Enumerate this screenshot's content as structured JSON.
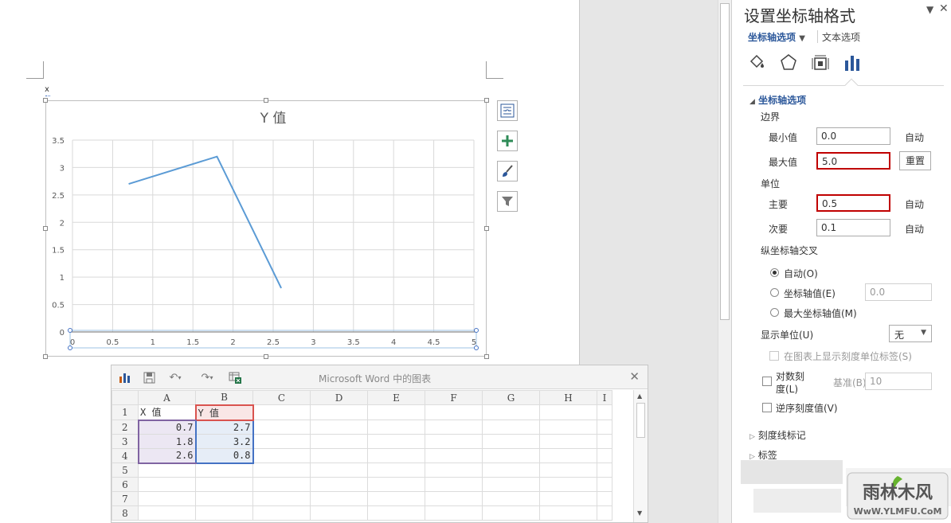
{
  "chart": {
    "title": "Y 值",
    "cursor_marker": "x"
  },
  "chart_data": {
    "type": "line",
    "title": "Y 值",
    "x": [
      0.7,
      1.8,
      2.6
    ],
    "series": [
      {
        "values": [
          2.7,
          3.2,
          0.8
        ]
      }
    ],
    "xlim": [
      0,
      5
    ],
    "ylim": [
      0,
      3.5
    ],
    "xticks": [
      "0",
      "0.5",
      "1",
      "1.5",
      "2",
      "2.5",
      "3",
      "3.5",
      "4",
      "4.5",
      "5"
    ],
    "yticks": [
      "0",
      "0.5",
      "1",
      "1.5",
      "2",
      "2.5",
      "3",
      "3.5"
    ],
    "grid": true,
    "series_color": "#5b9bd5"
  },
  "sheet": {
    "title": "Microsoft Word 中的图表",
    "close": "✕",
    "columns": [
      "A",
      "B",
      "C",
      "D",
      "E",
      "F",
      "G",
      "H",
      "I"
    ],
    "rows": [
      "1",
      "2",
      "3",
      "4",
      "5",
      "6",
      "7",
      "8"
    ],
    "header_a": "X 值",
    "header_b": "Y 值",
    "data": [
      [
        "0.7",
        "2.7"
      ],
      [
        "1.8",
        "3.2"
      ],
      [
        "2.6",
        "0.8"
      ]
    ]
  },
  "pane": {
    "title": "设置坐标轴格式",
    "tab_axis": "坐标轴选项",
    "tab_text": "文本选项",
    "section_axis": "坐标轴选项",
    "bounds": "边界",
    "min_label": "最小值",
    "min_value": "0.0",
    "min_auto": "自动",
    "max_label": "最大值",
    "max_value": "5.0",
    "reset": "重置",
    "units": "单位",
    "major_label": "主要",
    "major_value": "0.5",
    "major_auto": "自动",
    "minor_label": "次要",
    "minor_value": "0.1",
    "minor_auto": "自动",
    "cross_label": "纵坐标轴交叉",
    "cross_auto": "自动(O)",
    "cross_value_label": "坐标轴值(E)",
    "cross_value": "0.0",
    "cross_max": "最大坐标轴值(M)",
    "display_units": "显示单位(U)",
    "display_units_value": "无",
    "show_units_label": "在图表上显示刻度单位标签(S)",
    "log_scale_1": "对数刻",
    "log_scale_2": "度(L)",
    "base_label": "基准(B)",
    "base_value": "10",
    "reverse": "逆序刻度值(V)",
    "tick_marks": "刻度线标记",
    "labels": "标签"
  },
  "watermark": {
    "text": "雨林木风",
    "url": "WwW.YLMFU.CoM"
  }
}
